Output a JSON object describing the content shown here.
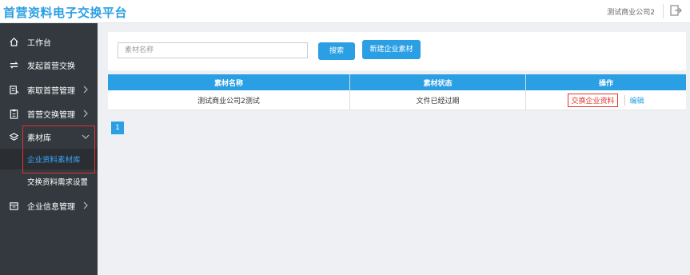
{
  "header": {
    "brand": "首营资料电子交换平台",
    "user": "测试商业公司2"
  },
  "sidebar": {
    "items": [
      {
        "label": "工作台",
        "icon": "home-icon"
      },
      {
        "label": "发起首营交换",
        "icon": "swap-icon"
      },
      {
        "label": "索取首营管理",
        "icon": "request-icon"
      },
      {
        "label": "首营交换管理",
        "icon": "clipboard-icon"
      },
      {
        "label": "素材库",
        "icon": "layers-icon"
      },
      {
        "label": "企业信息管理",
        "icon": "building-icon"
      }
    ],
    "sub_items": [
      {
        "label": "企业资料素材库",
        "active": true
      },
      {
        "label": "交换资料需求设置",
        "active": false
      }
    ]
  },
  "toolbar": {
    "search_placeholder": "素材名称",
    "search_label": "搜索",
    "new_label": "新建企业素材"
  },
  "table": {
    "headers": [
      "素材名称",
      "素材状态",
      "操作"
    ],
    "rows": [
      {
        "name": "测试商业公司2测试",
        "status": "文件已经过期",
        "exchange": "交换企业资料",
        "edit": "编辑"
      }
    ]
  },
  "pagination": {
    "current": "1"
  },
  "colors": {
    "accent": "#2b9fe4",
    "sidebar": "#33393f",
    "highlight": "#e0342d"
  }
}
